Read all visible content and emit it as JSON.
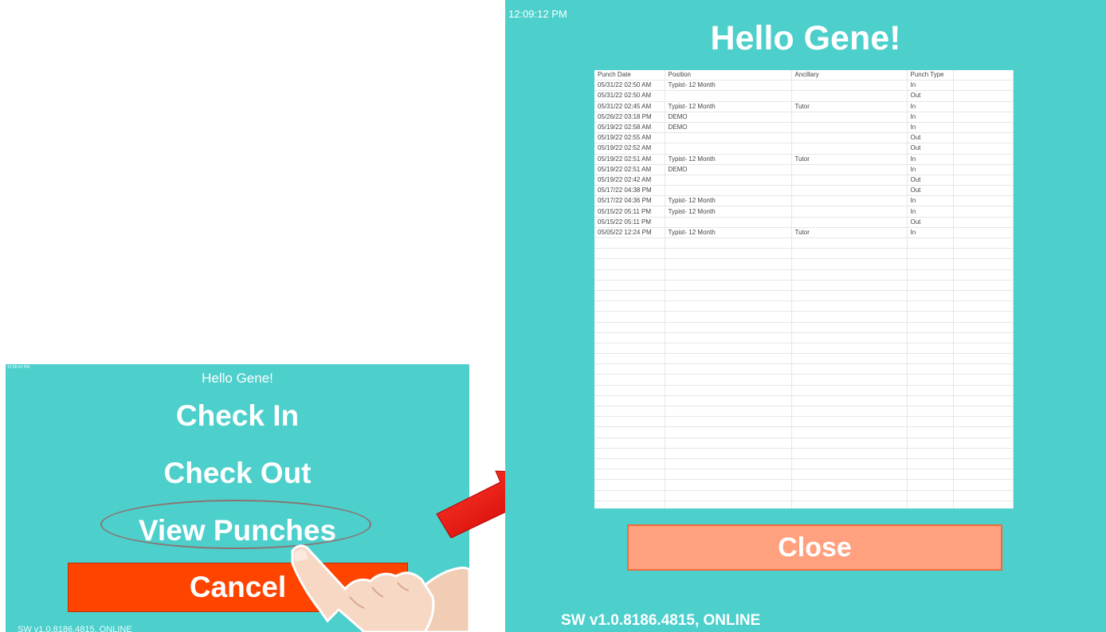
{
  "left_screen": {
    "clock": "12:08:42 PM",
    "greeting": "Hello Gene!",
    "options": [
      "Check In",
      "Check Out",
      "View Punches"
    ],
    "cancel_label": "Cancel",
    "footer": "SW v1.0.8186.4815, ONLINE"
  },
  "right_screen": {
    "clock": "12:09:12 PM",
    "greeting": "Hello Gene!",
    "table": {
      "headers": [
        "Punch Date",
        "Position",
        "Ancillary",
        "Punch Type",
        ""
      ],
      "rows": [
        [
          "05/31/22 02:50 AM",
          "Typist- 12 Month",
          "",
          "In",
          ""
        ],
        [
          "05/31/22 02:50 AM",
          "",
          "",
          "Out",
          ""
        ],
        [
          "05/31/22 02:45 AM",
          "Typist- 12 Month",
          "Tutor",
          "In",
          ""
        ],
        [
          "05/26/22 03:18 PM",
          "DEMO",
          "",
          "In",
          ""
        ],
        [
          "05/19/22 02:58 AM",
          "DEMO",
          "",
          "In",
          ""
        ],
        [
          "05/19/22 02:55 AM",
          "",
          "",
          "Out",
          ""
        ],
        [
          "05/19/22 02:52 AM",
          "",
          "",
          "Out",
          ""
        ],
        [
          "05/19/22 02:51 AM",
          "Typist- 12 Month",
          "Tutor",
          "In",
          ""
        ],
        [
          "05/19/22 02:51 AM",
          "DEMO",
          "",
          "In",
          ""
        ],
        [
          "05/19/22 02:42 AM",
          "",
          "",
          "Out",
          ""
        ],
        [
          "05/17/22 04:38 PM",
          "",
          "",
          "Out",
          ""
        ],
        [
          "05/17/22 04:36 PM",
          "Typist- 12 Month",
          "",
          "In",
          ""
        ],
        [
          "05/15/22 05:11 PM",
          "Typist- 12 Month",
          "",
          "In",
          ""
        ],
        [
          "05/15/22 05:11 PM",
          "",
          "",
          "Out",
          ""
        ],
        [
          "05/05/22 12:24 PM",
          "Typist- 12 Month",
          "Tutor",
          "In",
          ""
        ]
      ],
      "empty_rows": 27
    },
    "close_label": "Close",
    "footer": "SW v1.0.8186.4815, ONLINE"
  },
  "colors": {
    "background": "#4dcfcc",
    "cancel": "#ff4400",
    "close": "#ffa07e",
    "arrow": "#ee1111"
  },
  "icons": {
    "hand": "pointing-hand-icon",
    "arrow": "red-arrow-icon"
  }
}
